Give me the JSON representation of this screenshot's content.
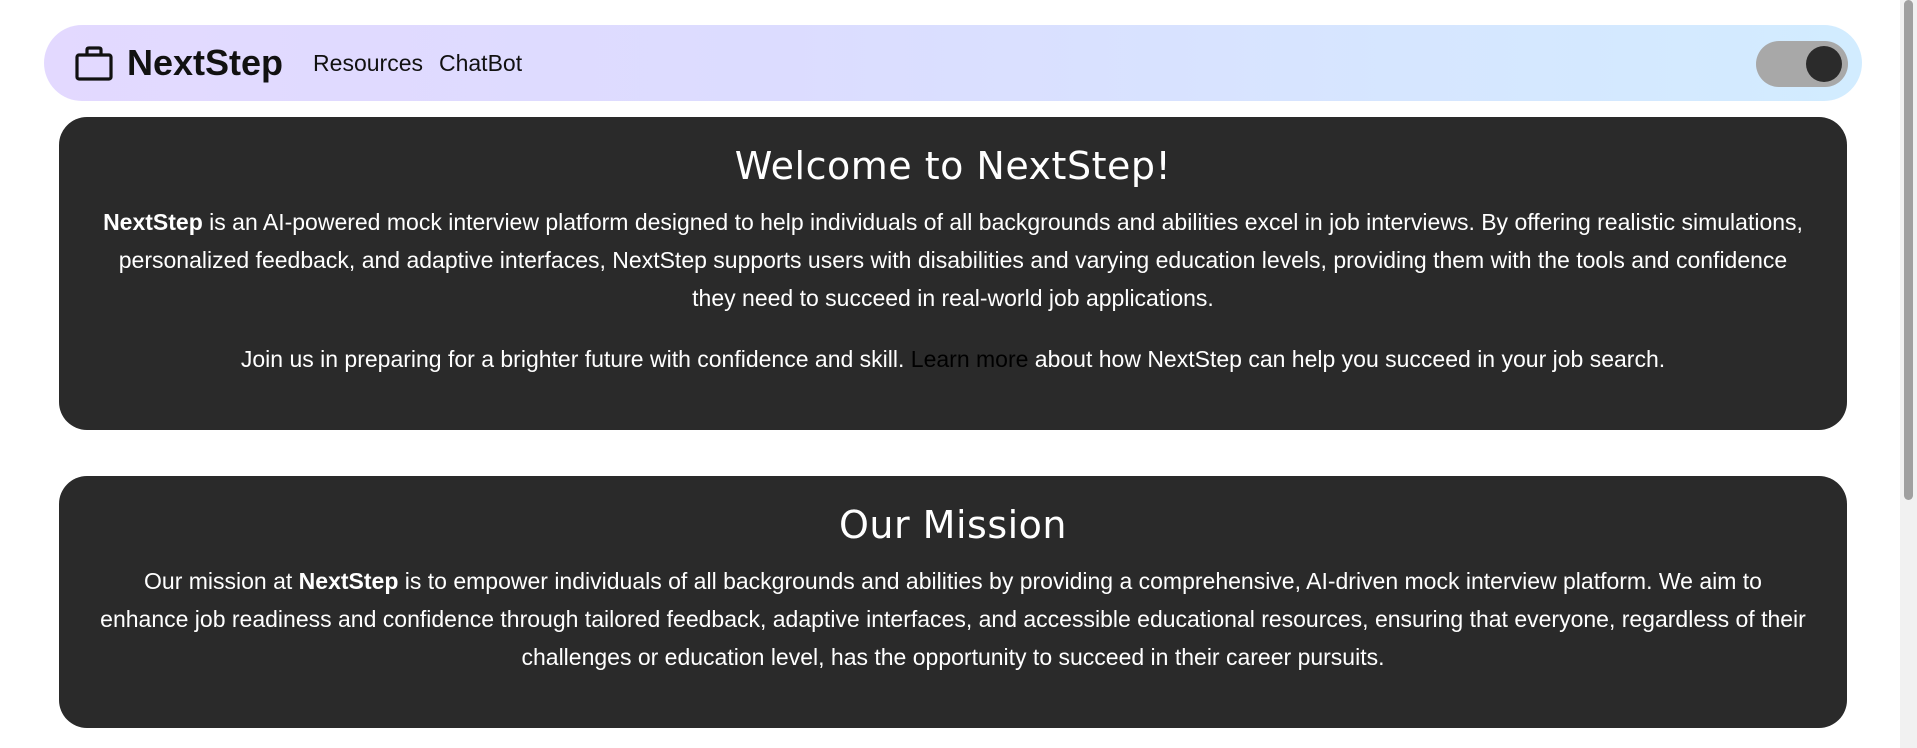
{
  "navbar": {
    "brand": "NextStep",
    "brand_icon": "briefcase-icon",
    "links": [
      "Resources",
      "ChatBot"
    ],
    "gradient_colors": [
      "#e3d9ff",
      "#d2ecff"
    ]
  },
  "theme_toggle": {
    "state": "dark",
    "track_color": "#a8a8a8",
    "knob_color": "#2b2b2b"
  },
  "welcome": {
    "title": "Welcome to NextStep!",
    "intro_bold": "NextStep",
    "intro_rest": " is an AI-powered mock interview platform designed to help individuals of all backgrounds and abilities excel in job interviews. By offering realistic simulations, personalized feedback, and adaptive interfaces, NextStep supports users with disabilities and varying education levels, providing them with the tools and confidence they need to succeed in real-world job applications.",
    "join_before": "Join us in preparing for a brighter future with confidence and skill. ",
    "join_link": "Learn more",
    "join_after": " about how NextStep can help you succeed in your job search."
  },
  "mission": {
    "title": "Our Mission",
    "text_before": "Our mission at ",
    "text_bold": "NextStep",
    "text_after": " is to empower individuals of all backgrounds and abilities by providing a comprehensive, AI-driven mock interview platform. We aim to enhance job readiness and confidence through tailored feedback, adaptive interfaces, and accessible educational resources, ensuring that everyone, regardless of their challenges or education level, has the opportunity to succeed in their career pursuits."
  },
  "colors": {
    "card_background": "#2a2a2a",
    "card_text": "#ffffff",
    "link_text": "#000000"
  }
}
